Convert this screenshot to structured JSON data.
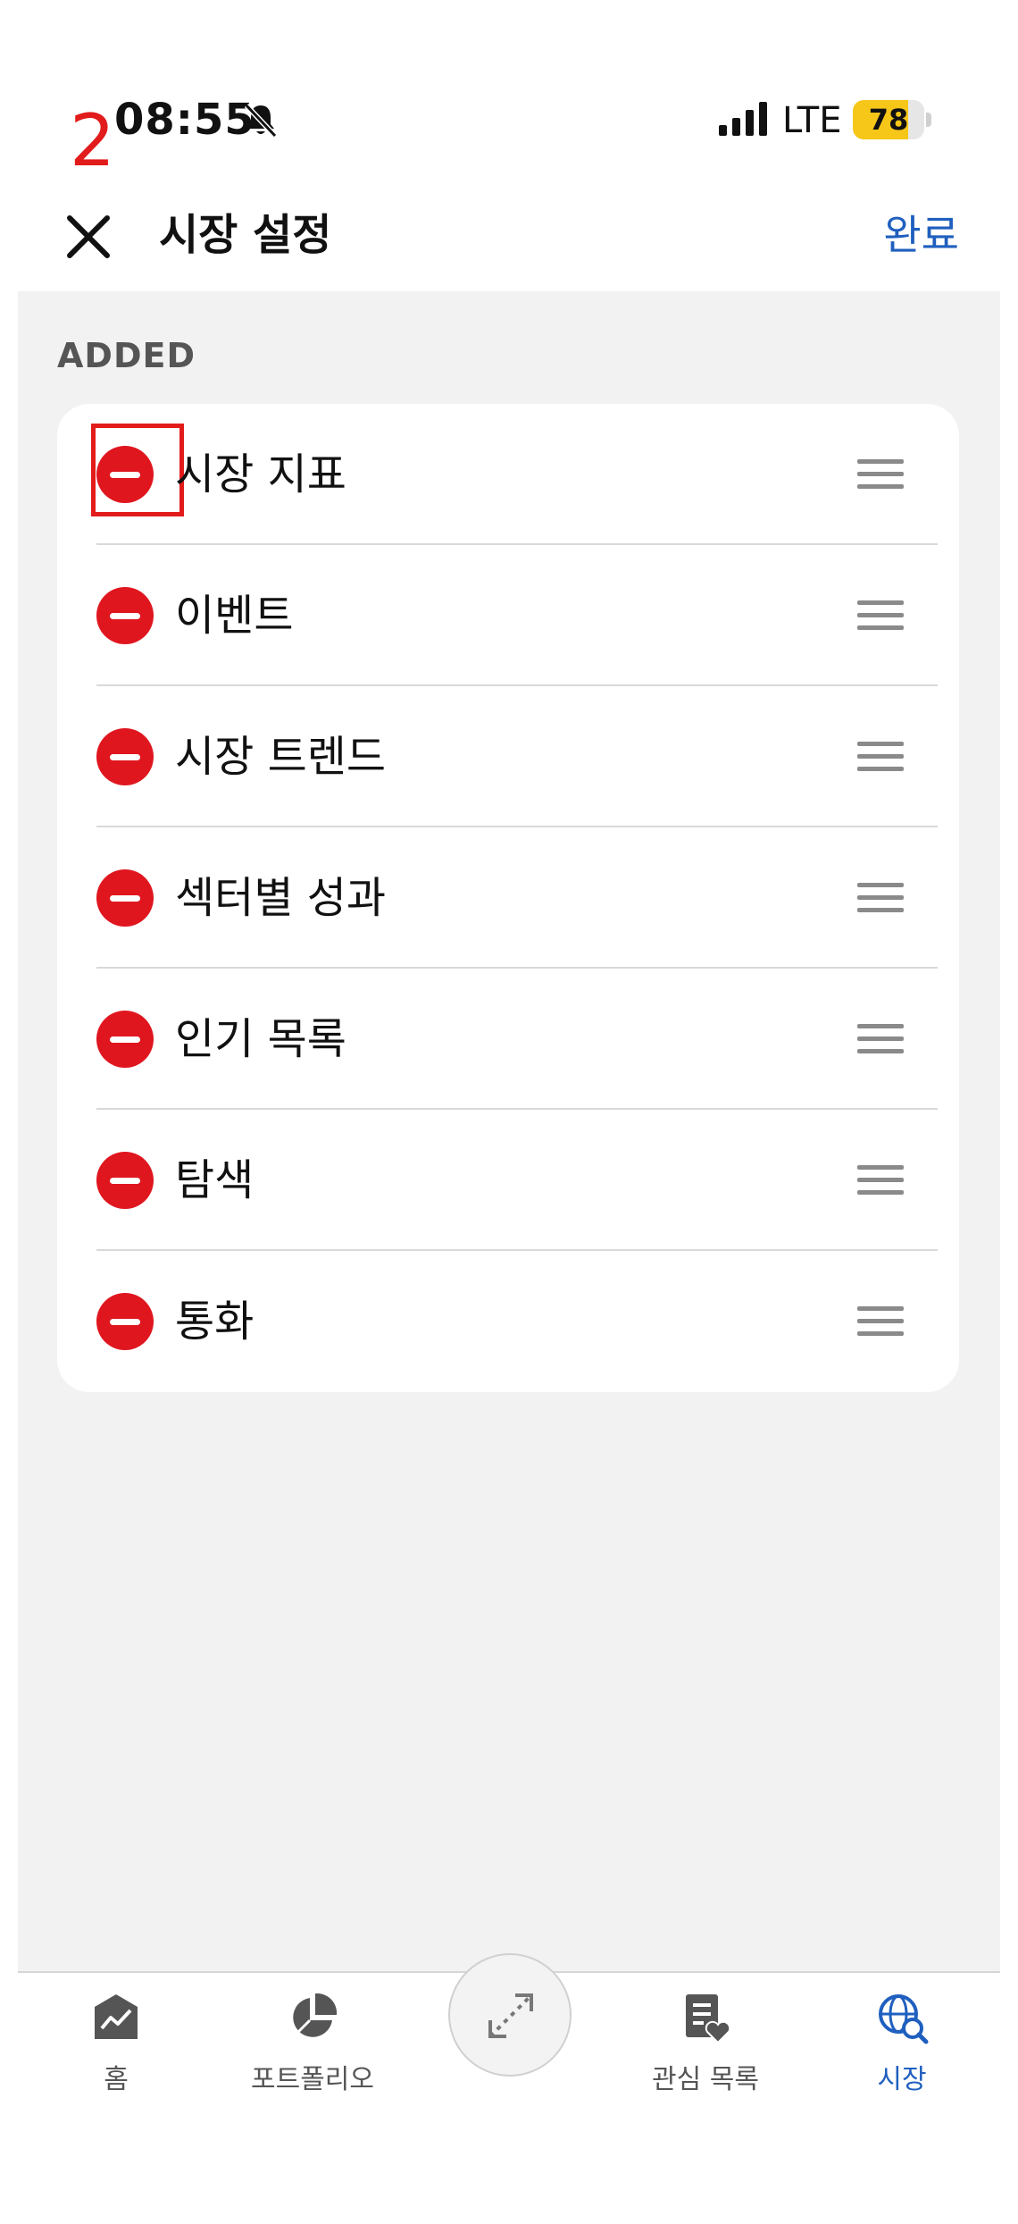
{
  "annotation": {
    "step_number": "2"
  },
  "status_bar": {
    "time": "08:55",
    "network": "LTE",
    "battery_level": 78,
    "battery_text": "78"
  },
  "header": {
    "title": "시장 설정",
    "done_label": "완료"
  },
  "section": {
    "label": "ADDED",
    "items": [
      {
        "label": "시장 지표"
      },
      {
        "label": "이벤트"
      },
      {
        "label": "시장 트렌드"
      },
      {
        "label": "섹터별 성과"
      },
      {
        "label": "인기 목록"
      },
      {
        "label": "탐색"
      },
      {
        "label": "통화"
      }
    ]
  },
  "tabbar": {
    "tabs": [
      {
        "label": "홈",
        "icon": "chart-home-icon"
      },
      {
        "label": "포트폴리오",
        "icon": "pie-chart-icon"
      },
      {
        "label": "관심 목록",
        "icon": "watchlist-icon"
      },
      {
        "label": "시장",
        "icon": "globe-search-icon",
        "active": true
      }
    ],
    "center_icon": "expand-arrows-icon"
  },
  "colors": {
    "accent": "#1f5fbf",
    "remove": "#e0161f",
    "annotation": "#e21b1b",
    "battery": "#f6c618"
  }
}
